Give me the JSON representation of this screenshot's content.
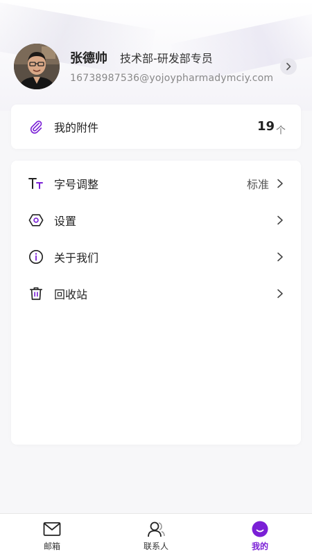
{
  "profile": {
    "name": "张德帅",
    "department": "技术部-研发部专员",
    "email": "16738987536@yojoypharmadymciy.com"
  },
  "attachments": {
    "label": "我的附件",
    "count": "19",
    "unit": "个"
  },
  "menu": {
    "items": [
      {
        "label": "字号调整",
        "value": "标准",
        "icon": "font-size-icon"
      },
      {
        "label": "设置",
        "value": "",
        "icon": "settings-hex-icon"
      },
      {
        "label": "关于我们",
        "value": "",
        "icon": "info-icon"
      },
      {
        "label": "回收站",
        "value": "",
        "icon": "trash-icon"
      }
    ]
  },
  "tabbar": {
    "tabs": [
      {
        "label": "邮箱",
        "icon": "mail-icon",
        "active": false
      },
      {
        "label": "联系人",
        "icon": "contacts-icon",
        "active": false
      },
      {
        "label": "我的",
        "icon": "profile-smile-icon",
        "active": true
      }
    ]
  },
  "colors": {
    "accent": "#7a1fd6",
    "background": "#f7f7f9",
    "card": "#ffffff"
  }
}
